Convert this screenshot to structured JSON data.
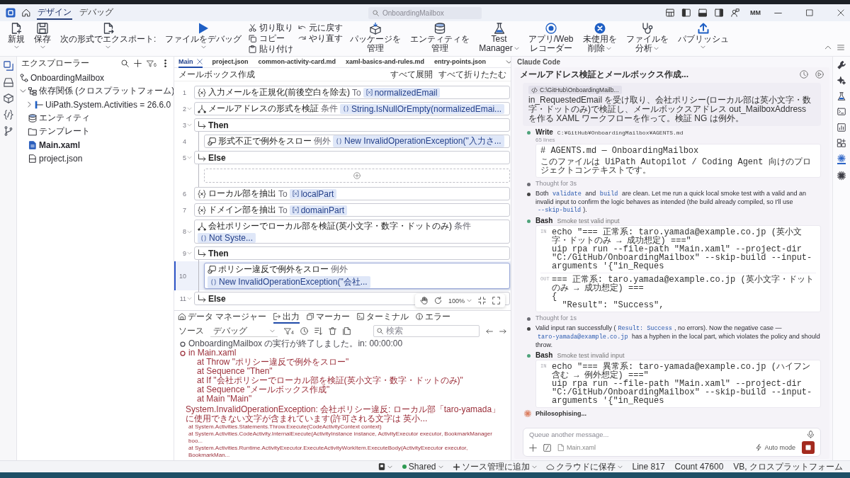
{
  "title_bar": {
    "tabs": [
      {
        "label": "デザイン",
        "selected": true
      },
      {
        "label": "デバッグ",
        "selected": false
      }
    ],
    "search": {
      "placeholder": "OnboardingMailbox"
    },
    "user": "MM"
  },
  "ribbon": [
    {
      "kind": "large",
      "label": [
        "新規"
      ],
      "dropdown": true
    },
    {
      "kind": "large",
      "label": [
        "保存"
      ],
      "dropdown": true
    },
    {
      "kind": "large",
      "label": [
        "次の形式でエクスポート:"
      ],
      "dropdown": true
    },
    {
      "kind": "large",
      "label": [
        "ファイルをデバッグ"
      ],
      "dropdown": true
    },
    {
      "kind": "stack",
      "items": [
        "切り取り",
        "コピー",
        "貼り付け"
      ]
    },
    {
      "kind": "stack",
      "items": [
        "元に戻す",
        "やり直す"
      ]
    },
    {
      "kind": "large",
      "label": [
        "パッケージを",
        "管理"
      ],
      "dropdown": false
    },
    {
      "kind": "large",
      "label": [
        "エンティティを",
        "管理"
      ],
      "dropdown": false
    },
    {
      "kind": "large",
      "label": [
        "Test",
        "Manager"
      ],
      "dropdown": true
    },
    {
      "kind": "large",
      "label": [
        "アプリ/Web",
        "レコーダー"
      ],
      "dropdown": false
    },
    {
      "kind": "large",
      "label": [
        "未使用を",
        "削除"
      ],
      "dropdown": true
    },
    {
      "kind": "large",
      "label": [
        "ファイルを",
        "分析"
      ],
      "dropdown": true
    },
    {
      "kind": "large",
      "label": [
        "パブリッシュ"
      ],
      "dropdown": true
    }
  ],
  "activity_bar": [
    {
      "selected": true
    },
    {
      "selected": false
    },
    {
      "selected": false
    },
    {
      "selected": false
    },
    {
      "selected": false
    }
  ],
  "explorer": {
    "title": "エクスプローラー",
    "filter_count": "6",
    "tree": [
      {
        "kind": "project",
        "label": "OnboardingMailbox",
        "emphasized": false,
        "children": [
          {
            "kind": "dependencies",
            "label": "依存関係 (クロスプラットフォーム)",
            "expanded": true,
            "emphasized": false,
            "children": [
              {
                "kind": "package",
                "label": "UiPath.System.Activities = 26.6.0",
                "expanded": false,
                "emphasized": false
              }
            ]
          },
          {
            "kind": "entities",
            "label": "エンティティ",
            "emphasized": false
          },
          {
            "kind": "folder",
            "label": "テンプレート",
            "emphasized": false
          },
          {
            "kind": "workflow",
            "label": "Main.xaml",
            "emphasized": true
          },
          {
            "kind": "json",
            "label": "project.json",
            "emphasized": false
          }
        ]
      }
    ]
  },
  "editor": {
    "tabs": [
      {
        "label": "Main",
        "selected": true
      },
      {
        "label": "project.json",
        "selected": false
      },
      {
        "label": "common-activity-card.md",
        "selected": false
      },
      {
        "label": "xaml-basics-and-rules.md",
        "selected": false
      },
      {
        "label": "entry-points.json",
        "selected": false
      }
    ],
    "breadcrumb": "メールボックス作成",
    "actions": [
      "すべて展開",
      "すべて折りたたむ"
    ],
    "rows": [
      {
        "kind": "assign",
        "line": "1",
        "label": "入力メールを正規化(前後空白を除去)",
        "keyword": "To",
        "expression": "normalizedEmail",
        "selected": false
      },
      {
        "kind": "if",
        "line": "2",
        "label": "メールアドレスの形式を検証",
        "keyword": "条件",
        "expression": "String.IsNullOrEmpty(normalizedEmai...",
        "expanded": true,
        "selected": false
      },
      {
        "kind": "branch",
        "line": "3",
        "label": "Then",
        "expanded": true,
        "selected": false,
        "children": [
          {
            "kind": "throw",
            "line": "4",
            "label": "形式不正で例外をスロー",
            "keyword": "例外",
            "expression": "New InvalidOperationException(\"入力さ...",
            "selected": false
          }
        ]
      },
      {
        "kind": "branch",
        "line": "5",
        "label": "Else",
        "expanded": true,
        "selected": false,
        "children": [
          {
            "kind": "drop-zone"
          }
        ]
      },
      {
        "kind": "assign",
        "line": "6",
        "label": "ローカル部を抽出",
        "keyword": "To",
        "expression": "localPart",
        "selected": false
      },
      {
        "kind": "assign",
        "line": "7",
        "label": "ドメイン部を抽出",
        "keyword": "To",
        "expression": "domainPart",
        "selected": false
      },
      {
        "kind": "if",
        "line": "8",
        "label": "会社ポリシーでローカル部を検証(英小文字・数字・ドットのみ)",
        "keyword": "条件",
        "expression": "Not Syste...",
        "expanded": true,
        "selected": false
      },
      {
        "kind": "branch",
        "line": "9",
        "label": "Then",
        "expanded": true,
        "selected": false,
        "children": [
          {
            "kind": "throw",
            "line": "10",
            "label": "ポリシー違反で例外をスロー",
            "keyword": "例外",
            "expression": "New InvalidOperationException(\"会社...",
            "selected": true
          }
        ]
      },
      {
        "kind": "branch",
        "line": "11",
        "label": "Else",
        "expanded": true,
        "selected": false
      }
    ],
    "zoom": "100%"
  },
  "bottom_panel": {
    "tabs": [
      {
        "label": "データ マネージャー",
        "selected": false
      },
      {
        "label": "出力",
        "selected": true
      },
      {
        "label": "マーカー",
        "selected": false
      },
      {
        "label": "ターミナル",
        "selected": false
      },
      {
        "label": "エラー",
        "selected": false
      }
    ],
    "source_label": "ソース",
    "source": "デバッグ",
    "filter_count": "4",
    "search": {
      "placeholder": "検索"
    },
    "log": [
      {
        "kind": "info",
        "text": "OnboardingMailbox の実行が終了しました。in: 00:00:00"
      },
      {
        "kind": "error",
        "text": "in Main.xaml",
        "trace": [
          "at Throw \"ポリシー違反で例外をスロー\"",
          "at Sequence \"Then\"",
          "at If \"会社ポリシーでローカル部を検証(英小文字・数字・ドットのみ)\"",
          "at Sequence \"メールボックス作成\"",
          "at Main \"Main\""
        ],
        "exception": "System.InvalidOperationException: 会社ポリシー違反: ローカル部「taro-yamada」に使用できない文字が含まれています(許可される文字は 英小...",
        "stack": [
          "at System.Activities.Statements.Throw.Execute(CodeActivityContext context)",
          "at System.Activities.CodeActivity.InternalExecute(ActivityInstance instance, ActivityExecutor executor, BookmarkManager boo...",
          "at System.Activities.Runtime.ActivityExecutor.ExecuteActivityWorkItem.ExecuteBody(ActivityExecutor executor, BookmarkMan..."
        ]
      }
    ]
  },
  "claude": {
    "title": "Claude Code",
    "conversation": "メールアドレス検証とメールボックス作成...",
    "prompt": {
      "attachment": "C:\\GitHub\\OnboardingMailb...",
      "text": "in_RequestedEmail を受け取り、会社ポリシー(ローカル部は英小文字・数字・ドットのみ)で検証し、メールボックスアドレス out_MailboxAddress を作る XAML ワークフローを作って。検証 NG は例外。"
    },
    "messages": [
      {
        "kind": "file-write",
        "tool": "Write",
        "detail": "C:¥GitHub¥OnboardingMailbox¥AGENTS.md",
        "meta": "65 lines",
        "blocks": [
          {
            "lines": [
              "# AGENTS.md — OnboardingMailbox",
              "このファイルは UiPath Autopilot / Coding Agent 向けのプロジェクトコンテキストです。"
            ]
          }
        ]
      },
      {
        "kind": "thought",
        "text": "Thought for 3s"
      },
      {
        "kind": "text",
        "parts": [
          {
            "kind": "text",
            "text": "Both "
          },
          {
            "kind": "code",
            "text": "validate"
          },
          {
            "kind": "text",
            "text": " and "
          },
          {
            "kind": "code",
            "text": "build"
          },
          {
            "kind": "text",
            "text": " are clean. Let me run a quick local smoke test with a valid and an invalid input to confirm the logic behaves as intended (the build already compiled, so I'll use "
          },
          {
            "kind": "code",
            "text": "--skip-build"
          },
          {
            "kind": "text",
            "text": ")."
          }
        ]
      },
      {
        "kind": "command",
        "tool": "Bash",
        "detail": "Smoke test valid input",
        "blocks": [
          {
            "label": "IN",
            "lines": [
              "echo \"=== 正常系: taro.yamada@example.co.jp (英小文字・ドットのみ → 成功想定) ===\"",
              "uip rpa run --file-path \"Main.xaml\" --project-dir \"C:/GitHub/OnboardingMailbox\" --skip-build --input-arguments '{\"in_Reques"
            ]
          },
          {
            "label": "OUT",
            "lines": [
              "=== 正常系: taro.yamada@example.co.jp (英小文字・ドットのみ → 成功想定) ===",
              "{",
              "  \"Result\": \"Success\","
            ]
          }
        ]
      },
      {
        "kind": "thought",
        "text": "Thought for 1s"
      },
      {
        "kind": "text",
        "parts": [
          {
            "kind": "text",
            "text": "Valid input ran successfully ("
          },
          {
            "kind": "code",
            "text": "Result: Success"
          },
          {
            "kind": "text",
            "text": ", no errors). Now the negative case — "
          },
          {
            "kind": "code",
            "text": "taro-yamada@example.co.jp"
          },
          {
            "kind": "text",
            "text": " has a hyphen in the local part, which violates the policy and should throw."
          }
        ]
      },
      {
        "kind": "command",
        "tool": "Bash",
        "detail": "Smoke test invalid input",
        "blocks": [
          {
            "label": "IN",
            "lines": [
              "echo \"=== 異常系: taro-yamada@example.co.jp (ハイフン含む → 例外想定) ===\"",
              "uip rpa run --file-path \"Main.xaml\" --project-dir \"C:/GitHub/OnboardingMailbox\" --skip-build --input-arguments '{\"in_Reques"
            ]
          }
        ]
      }
    ],
    "status": "Philosophising...",
    "composer": {
      "placeholder": "Queue another message...",
      "file": "Main.xaml",
      "mode": "Auto mode"
    }
  },
  "right_toolbar": [
    {
      "selected": false
    },
    {
      "selected": false
    },
    {
      "selected": false
    },
    {
      "selected": false
    },
    {
      "selected": false
    },
    {
      "selected": false
    },
    {
      "selected": true
    },
    {
      "selected": false
    }
  ],
  "status_bar": {
    "workspace": "Shared",
    "source_control": "ソース管理に追加",
    "save": "クラウドに保存",
    "line": "Line 817",
    "count": "Count 47600",
    "language": "VB, クロスプラットフォーム"
  }
}
